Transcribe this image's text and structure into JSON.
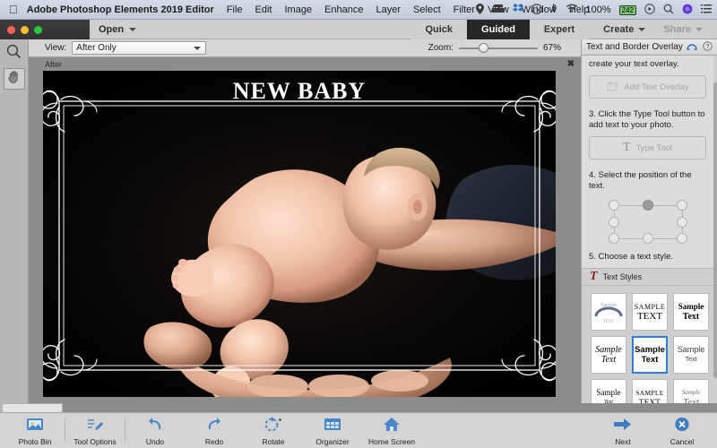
{
  "macbar": {
    "apple_icon": "apple-logo",
    "app_name": "Adobe Photoshop Elements 2019 Editor",
    "menus": [
      "File",
      "Edit",
      "Image",
      "Enhance",
      "Layer",
      "Select",
      "Filter",
      "View",
      "Window",
      "Help"
    ],
    "status_icons": [
      "location-icon",
      "box-icon",
      "dropbox-icon",
      "time-machine-icon",
      "bluetooth-icon",
      "wifi-icon"
    ],
    "battery_percent": "100%",
    "battery_badge": "242",
    "right_icons": [
      "control-center-icon",
      "search-icon",
      "siri-icon",
      "notifications-icon"
    ]
  },
  "toolbar": {
    "open_label": "Open",
    "modes": [
      {
        "label": "Quick",
        "active": false
      },
      {
        "label": "Guided",
        "active": true
      },
      {
        "label": "Expert",
        "active": false
      }
    ],
    "create_label": "Create",
    "share_label": "Share"
  },
  "options": {
    "view_label": "View:",
    "view_value": "After Only",
    "zoom_label": "Zoom:",
    "zoom_value": "67%",
    "zoom_slider_pct": 25
  },
  "tools": [
    {
      "name": "zoom-tool",
      "icon": "magnifier-icon",
      "selected": false
    },
    {
      "name": "hand-tool",
      "icon": "hand-icon",
      "selected": true
    }
  ],
  "canvas": {
    "after_label": "After",
    "close_label": "✖",
    "overlay_title": "NEW BABY",
    "photo_alt": "newborn baby held in adult hands on black background"
  },
  "panel": {
    "title": "Text and Border Overlay",
    "header_icons": [
      "undo-arc-icon",
      "help-icon"
    ],
    "steps": [
      {
        "text": "create your text overlay.",
        "button": "Add Text Overlay",
        "button_icon": "add-text-overlay-icon"
      },
      {
        "text": "3. Click the Type Tool button to add text to your photo.",
        "button": "Type Tool",
        "button_icon": "type-tool-icon"
      },
      {
        "text": "4. Select the position of the text.",
        "button": null,
        "button_icon": null
      },
      {
        "text": "5. Choose a text style.",
        "button": null,
        "button_icon": null
      }
    ],
    "styles_header": {
      "icon": "text-style-icon",
      "label": "Text Styles"
    },
    "styles": [
      {
        "line1": "Sample",
        "line2": "TEXT",
        "selected": false,
        "variant": "arched"
      },
      {
        "line1": "SAMPLE",
        "line2": "TEXT",
        "selected": false,
        "variant": "serif-caps"
      },
      {
        "line1": "Sample",
        "line2": "Text",
        "selected": false,
        "variant": "bold-serif"
      },
      {
        "line1": "Sample",
        "line2": "Text",
        "selected": false,
        "variant": "italic-serif"
      },
      {
        "line1": "Sample",
        "line2": "Text",
        "selected": true,
        "variant": "bold-sans"
      },
      {
        "line1": "Sample",
        "line2": "Text",
        "selected": false,
        "variant": "outline"
      },
      {
        "line1": "Sample",
        "line2": "Text",
        "selected": false,
        "variant": "small-script"
      },
      {
        "line1": "SAMPLE",
        "line2": "TEXT",
        "selected": false,
        "variant": "smallcaps"
      },
      {
        "line1": "Sample",
        "line2": "Text",
        "selected": false,
        "variant": "light-italic"
      }
    ]
  },
  "bottom": {
    "items": [
      {
        "label": "Photo Bin",
        "icon": "photo-bin-icon"
      },
      {
        "label": "Tool Options",
        "icon": "tool-options-icon"
      },
      {
        "label": "Undo",
        "icon": "undo-icon"
      },
      {
        "label": "Redo",
        "icon": "redo-icon"
      },
      {
        "label": "Rotate",
        "icon": "rotate-icon"
      },
      {
        "label": "Organizer",
        "icon": "organizer-icon"
      },
      {
        "label": "Home Screen",
        "icon": "home-icon"
      }
    ],
    "next_label": "Next",
    "next_icon": "arrow-right-icon",
    "cancel_label": "Cancel",
    "cancel_icon": "cancel-circle-icon"
  },
  "colors": {
    "accent_blue": "#2f7fd6",
    "panel_bg": "#dcdcdc",
    "workspace_gray": "#8c8c8c",
    "dark_tab": "#272727"
  }
}
